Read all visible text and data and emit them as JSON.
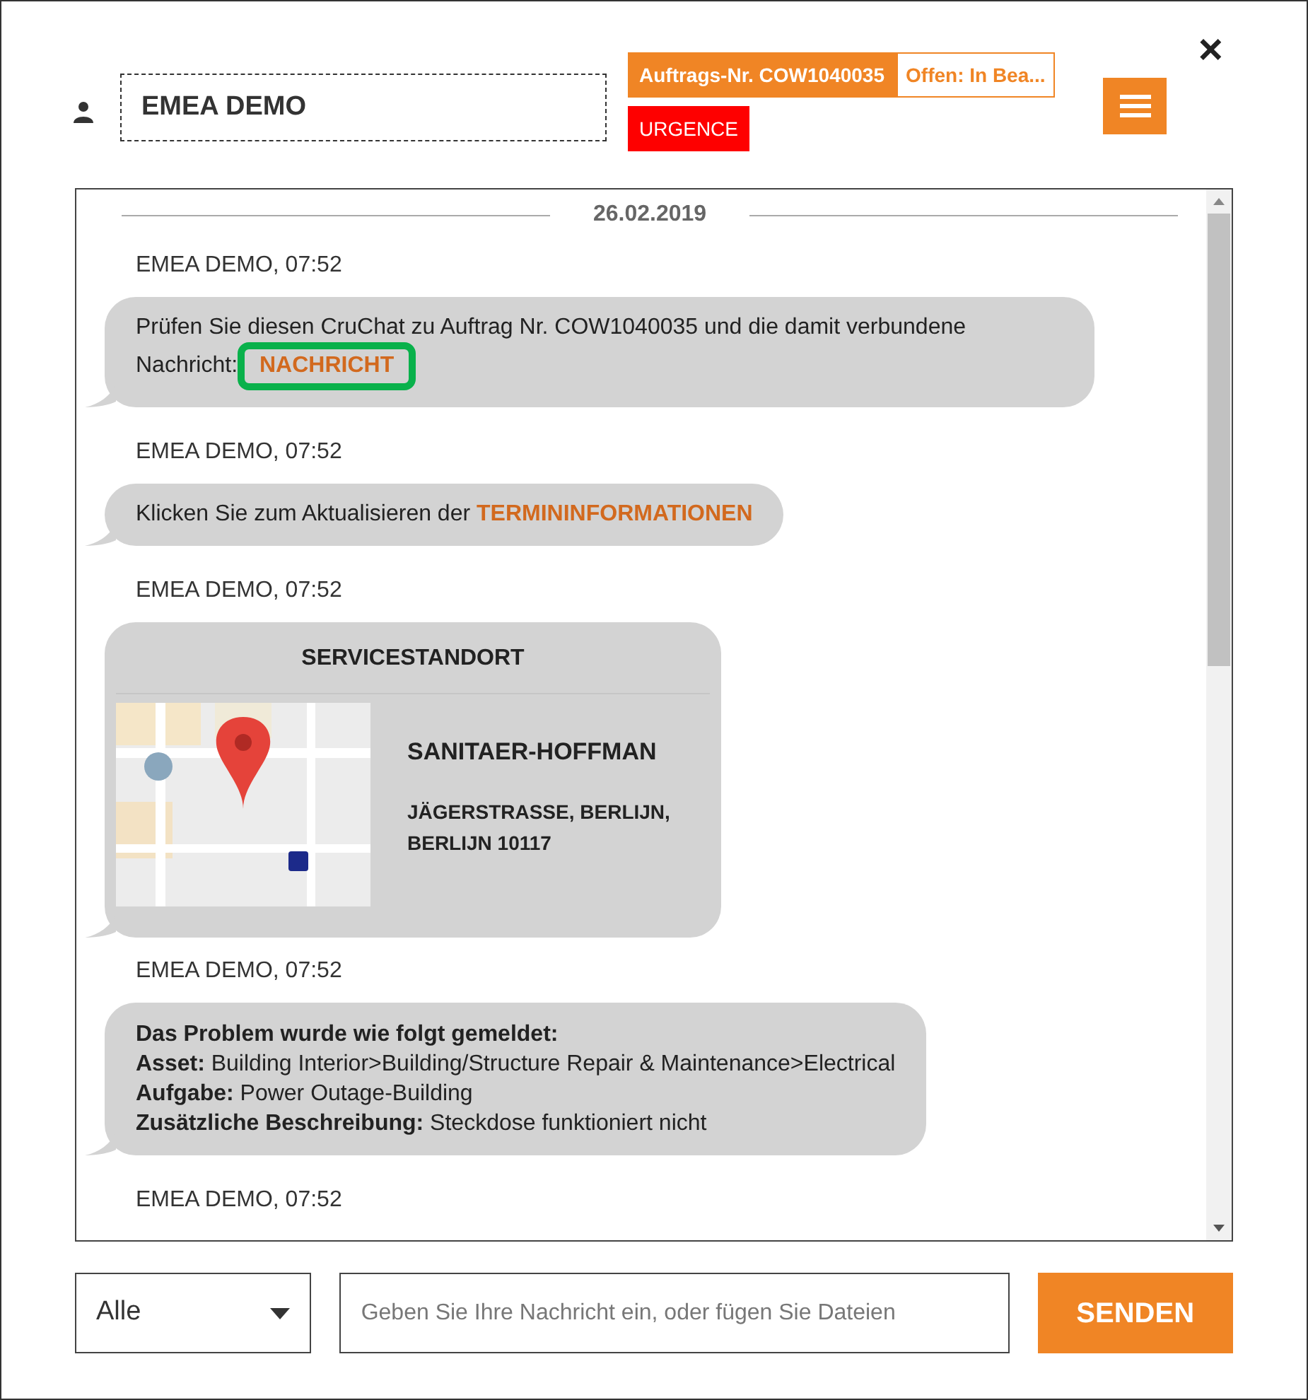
{
  "header": {
    "user_name": "EMEA DEMO",
    "order_badge": "Auftrags-Nr. COW1040035",
    "status_badge": "Offen: In Bea...",
    "priority_badge": "URGENCE",
    "close": "×"
  },
  "chat": {
    "date": "26.02.2019",
    "messages": [
      {
        "kind": "text",
        "author": "EMEA DEMO, 07:52",
        "text": "Prüfen Sie diesen CruChat zu Auftrag Nr. COW1040035 und die damit verbundene Nachricht:",
        "link": "NACHRICHT",
        "highlighted": true
      },
      {
        "kind": "text",
        "author": "EMEA DEMO, 07:52",
        "text": "Klicken Sie zum Aktualisieren der",
        "link": "TERMININFORMATIONEN",
        "highlighted": false
      },
      {
        "kind": "location",
        "author": "EMEA DEMO, 07:52",
        "title": "SERVICESTANDORT",
        "name": "SANITAER-HOFFMAN",
        "address": "JÄGERSTRASSE, BERLIJN, BERLIJN 10117"
      },
      {
        "kind": "problem",
        "author": "EMEA DEMO, 07:52",
        "heading": "Das Problem wurde wie folgt gemeldet:",
        "fields": [
          {
            "label": "Asset:",
            "value": "Building Interior>Building/Structure Repair & Maintenance>Electrical"
          },
          {
            "label": "Aufgabe:",
            "value": "Power Outage-Building"
          },
          {
            "label": "Zusätzliche Beschreibung:",
            "value": "Steckdose funktioniert nicht"
          }
        ]
      },
      {
        "kind": "author_only",
        "author": "EMEA DEMO, 07:52"
      }
    ]
  },
  "footer": {
    "filter": "Alle",
    "message_placeholder": "Geben Sie Ihre Nachricht ein, oder fügen Sie Dateien",
    "send": "SENDEN"
  }
}
